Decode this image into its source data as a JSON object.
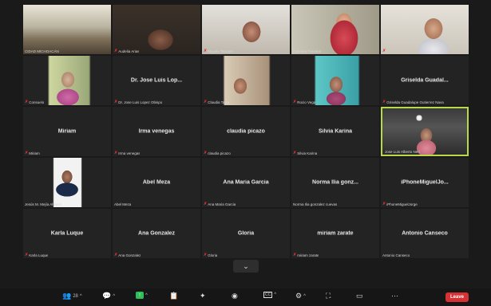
{
  "tiles": [
    {
      "label": "CIDAD MICHOACÁN",
      "name": "",
      "muted": false
    },
    {
      "label": "Audelia Arias",
      "name": "",
      "muted": true
    },
    {
      "label": "Mayela Tamayo",
      "name": "",
      "muted": true
    },
    {
      "label": "Gabriela Paredes",
      "name": "",
      "muted": false
    },
    {
      "label": "",
      "name": "",
      "muted": true
    },
    {
      "label": "Consuelo",
      "name": "",
      "muted": true
    },
    {
      "label": "Dr. Jose Luis Lopez Obispo",
      "name": "Dr. Jose Luis Lop...",
      "muted": true
    },
    {
      "label": "Claudia Tapia",
      "name": "",
      "muted": true
    },
    {
      "label": "Rocio Vega",
      "name": "",
      "muted": true
    },
    {
      "label": "Griselda Guadalupe Gutierrez Nava",
      "name": "Griselda Guadal...",
      "muted": true
    },
    {
      "label": "Miriam",
      "name": "Miriam",
      "muted": true
    },
    {
      "label": "Irma venegas",
      "name": "Irma venegas",
      "muted": true
    },
    {
      "label": "claudia picazo",
      "name": "claudia picazo",
      "muted": true
    },
    {
      "label": "Silvia Karina",
      "name": "Silvia Karina",
      "muted": true
    },
    {
      "label": "Jose Luis Alberto Neri",
      "name": "",
      "muted": false
    },
    {
      "label": "Jesús M. Mejía Alvarez",
      "name": "",
      "muted": false
    },
    {
      "label": "Abel Meza",
      "name": "Abel Meza",
      "muted": false
    },
    {
      "label": "Ana Maria Garcia",
      "name": "Ana Maria Garcia",
      "muted": true
    },
    {
      "label": "Norma Ilia gonzalez cuevas",
      "name": "Norma Ilia gonz...",
      "muted": false
    },
    {
      "label": "iPhoneMiguelJorge",
      "name": "iPhoneMiguelJo...",
      "muted": true
    },
    {
      "label": "Karla Luque",
      "name": "Karla Luque",
      "muted": true
    },
    {
      "label": "Ana Gonzalez",
      "name": "Ana Gonzalez",
      "muted": true
    },
    {
      "label": "Gloria",
      "name": "Gloria",
      "muted": true
    },
    {
      "label": "miriam zarate",
      "name": "miriam zarate",
      "muted": true
    },
    {
      "label": "Antonio Canseco",
      "name": "Antonio Canseco",
      "muted": false
    }
  ],
  "toolbar": {
    "participants_count": "28",
    "leave_label": "Leave"
  }
}
